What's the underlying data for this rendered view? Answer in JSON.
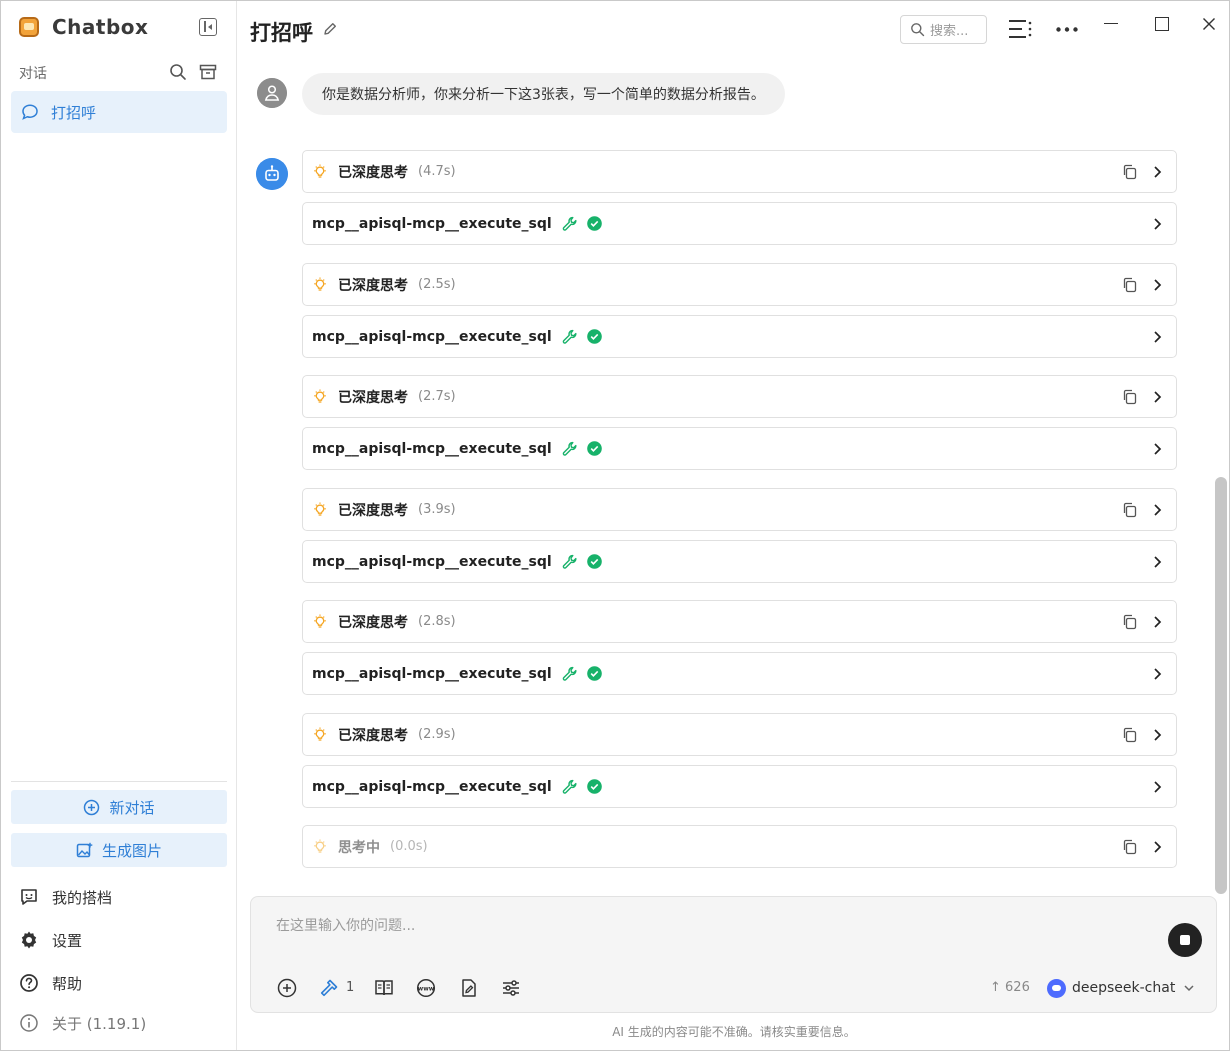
{
  "app": {
    "name": "Chatbox",
    "version": "关于 (1.19.1)"
  },
  "sidebar": {
    "section_label": "对话",
    "conversations": [
      {
        "label": "打招呼",
        "active": true
      }
    ],
    "new_chat": "新对话",
    "gen_image": "生成图片",
    "links": {
      "copilots": "我的搭档",
      "settings": "设置",
      "help": "帮助"
    }
  },
  "header": {
    "title": "打招呼",
    "search_placeholder": "搜索..."
  },
  "messages": {
    "user_text": "你是数据分析师，你来分析一下这3张表，写一个简单的数据分析报告。",
    "steps": [
      {
        "thinking_label": "已深度思考",
        "thinking_time": "(4.7s)",
        "tool_name": "mcp__apisql-mcp__execute_sql"
      },
      {
        "thinking_label": "已深度思考",
        "thinking_time": "(2.5s)",
        "tool_name": "mcp__apisql-mcp__execute_sql"
      },
      {
        "thinking_label": "已深度思考",
        "thinking_time": "(2.7s)",
        "tool_name": "mcp__apisql-mcp__execute_sql"
      },
      {
        "thinking_label": "已深度思考",
        "thinking_time": "(3.9s)",
        "tool_name": "mcp__apisql-mcp__execute_sql"
      },
      {
        "thinking_label": "已深度思考",
        "thinking_time": "(2.8s)",
        "tool_name": "mcp__apisql-mcp__execute_sql"
      },
      {
        "thinking_label": "已深度思考",
        "thinking_time": "(2.9s)",
        "tool_name": "mcp__apisql-mcp__execute_sql"
      }
    ],
    "pending": {
      "thinking_label": "思考中",
      "thinking_time": "(0.0s)"
    }
  },
  "composer": {
    "placeholder": "在这里输入你的问题...",
    "mcp_tool_count": "1",
    "token_count": "626",
    "model": "deepseek-chat"
  },
  "footer": {
    "disclaimer": "AI 生成的内容可能不准确。请核实重要信息。"
  },
  "colors": {
    "accent": "#2f7fd6",
    "accent_bg": "#e7f1fb",
    "success": "#17b26a",
    "bulb": "#f5a623",
    "model_brand": "#4d6bfe"
  }
}
